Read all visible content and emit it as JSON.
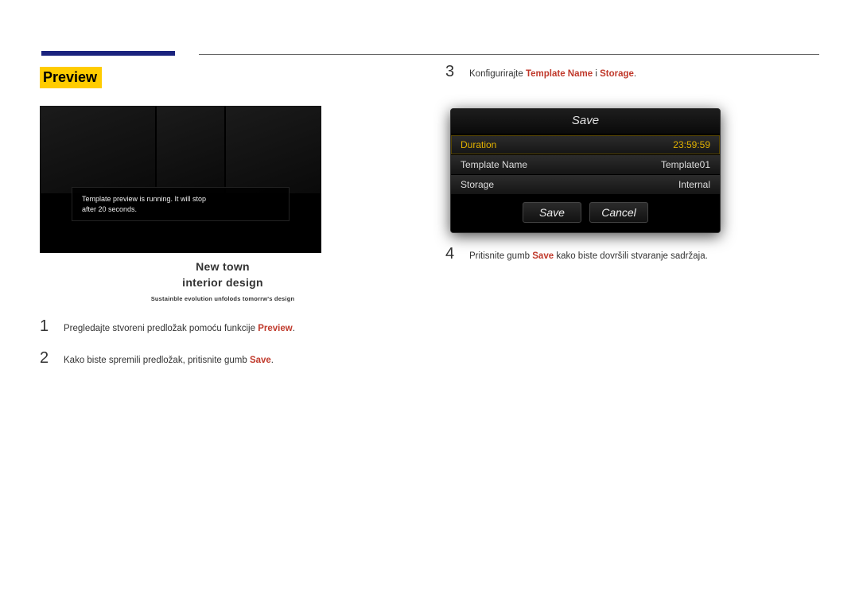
{
  "section_title": "Preview",
  "preview_running_text": "Template preview is running. It will stop after 20 seconds.",
  "content": {
    "title_line1": "New town",
    "title_line2": "interior design",
    "subtitle": "Sustainble evolution unfolods tomorrw's design"
  },
  "steps_left": [
    {
      "num": "1",
      "pre": "Pregledajte stvoreni predložak pomoću funkcije ",
      "hl": "Preview",
      "post": "."
    },
    {
      "num": "2",
      "pre": "Kako biste spremili predložak, pritisnite gumb ",
      "hl": "Save",
      "post": "."
    }
  ],
  "steps_right": [
    {
      "num": "3",
      "pre": "Konfigurirajte ",
      "hl1": "Template Name",
      "mid": " i ",
      "hl2": "Storage",
      "post": "."
    },
    {
      "num": "4",
      "pre": "Pritisnite gumb ",
      "hl": "Save",
      "post": " kako biste dovršili stvaranje sadržaja."
    }
  ],
  "dialog": {
    "title": "Save",
    "rows": [
      {
        "label": "Duration",
        "value": "23:59:59",
        "selected": true
      },
      {
        "label": "Template Name",
        "value": "Template01",
        "selected": false
      },
      {
        "label": "Storage",
        "value": "Internal",
        "selected": false
      }
    ],
    "save_btn": "Save",
    "cancel_btn": "Cancel"
  }
}
